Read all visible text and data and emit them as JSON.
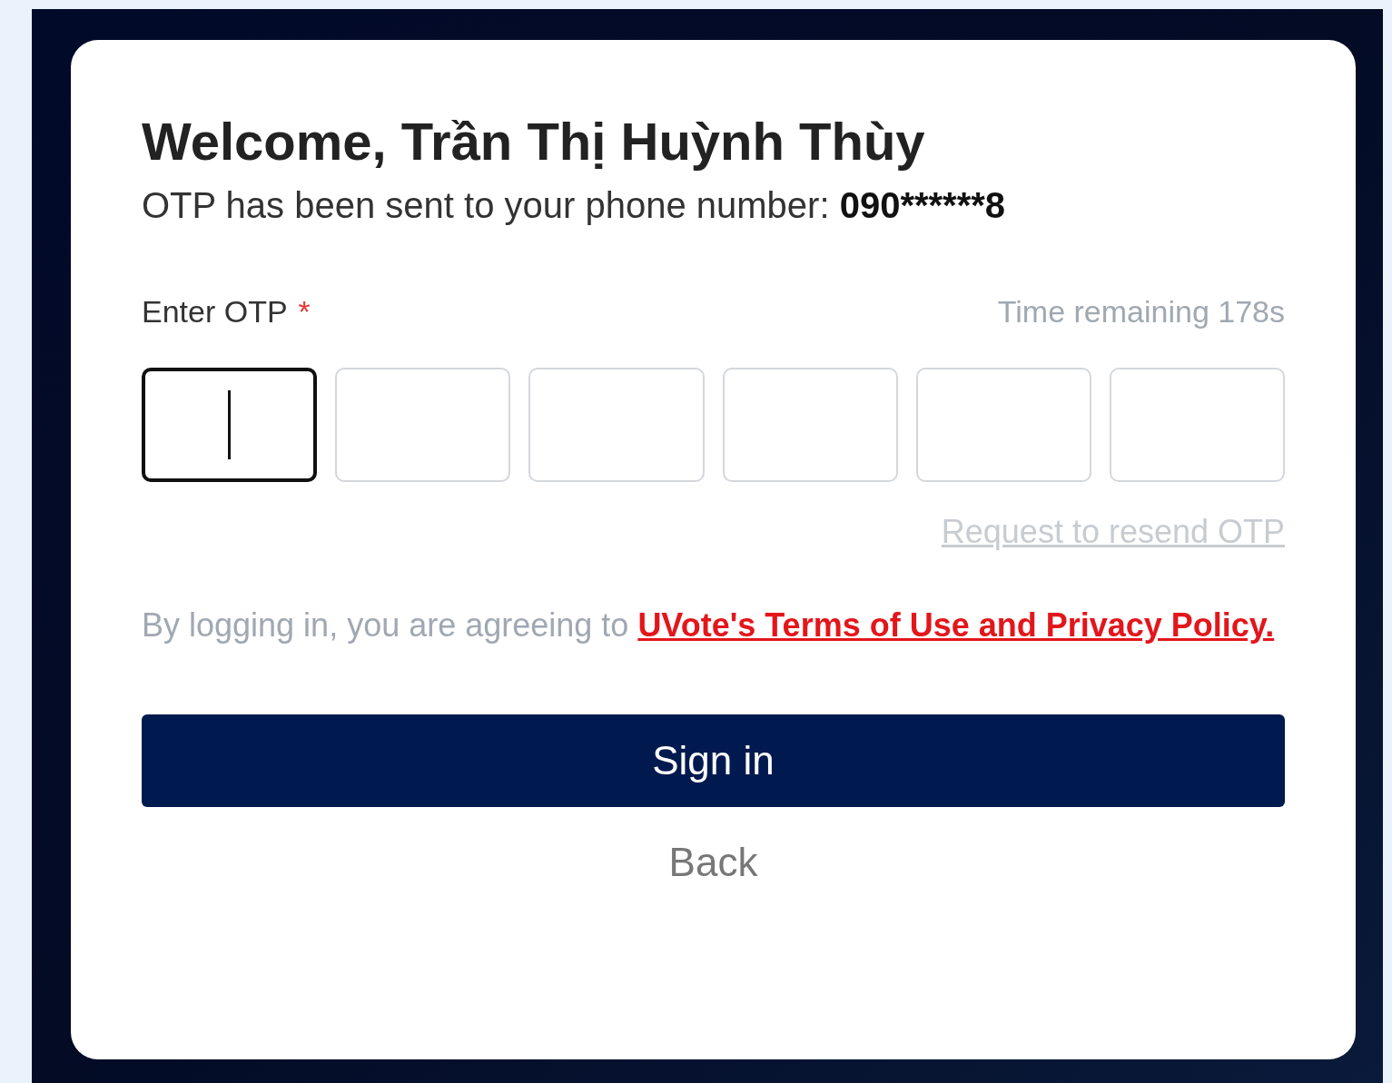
{
  "card": {
    "title": "Welcome, Trần Thị Huỳnh Thùy",
    "otp_message": "OTP has been sent to your phone number: ",
    "phone": "090******8",
    "otp_label": "Enter OTP",
    "required_mark": "*",
    "timer": "Time remaining 178s",
    "otp_boxes": [
      {
        "focused": true
      },
      {
        "focused": false
      },
      {
        "focused": false
      },
      {
        "focused": false
      },
      {
        "focused": false
      },
      {
        "focused": false
      }
    ],
    "resend_link": {
      "label": "Request to resend OTP",
      "disabled": true
    },
    "terms_text": "By logging in, you are agreeing to ",
    "terms_link": "UVote's Terms of Use and Privacy Policy.",
    "sign_in_button": "Sign in",
    "back_button": "Back"
  }
}
